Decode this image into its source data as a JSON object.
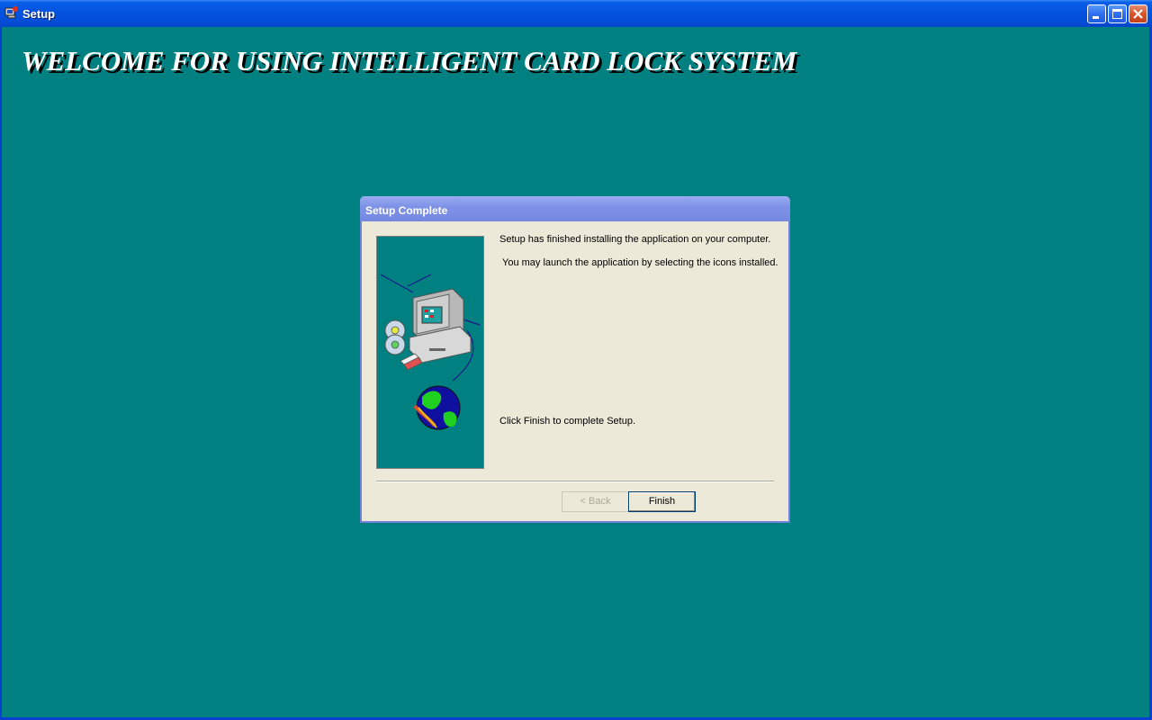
{
  "window": {
    "title": "Setup",
    "icon": "setup-app-icon",
    "controls": [
      "minimize-icon",
      "maximize-icon",
      "close-icon"
    ]
  },
  "banner": {
    "text": "WELCOME FOR USING INTELLIGENT CARD LOCK SYSTEM"
  },
  "dialog": {
    "title": "Setup Complete",
    "illustration": "computer-cd-globe-illustration",
    "message1": "Setup has finished installing the application on your computer.",
    "message2": "You may launch the application by selecting the icons installed.",
    "message3": "Click Finish to complete Setup.",
    "back_label": "< Back",
    "finish_label": "Finish"
  },
  "colors": {
    "desktop": "#008080",
    "titlebar": "#0454e0",
    "dialog_face": "#ece9d8",
    "dialog_titlebar": "#7e93e8"
  }
}
